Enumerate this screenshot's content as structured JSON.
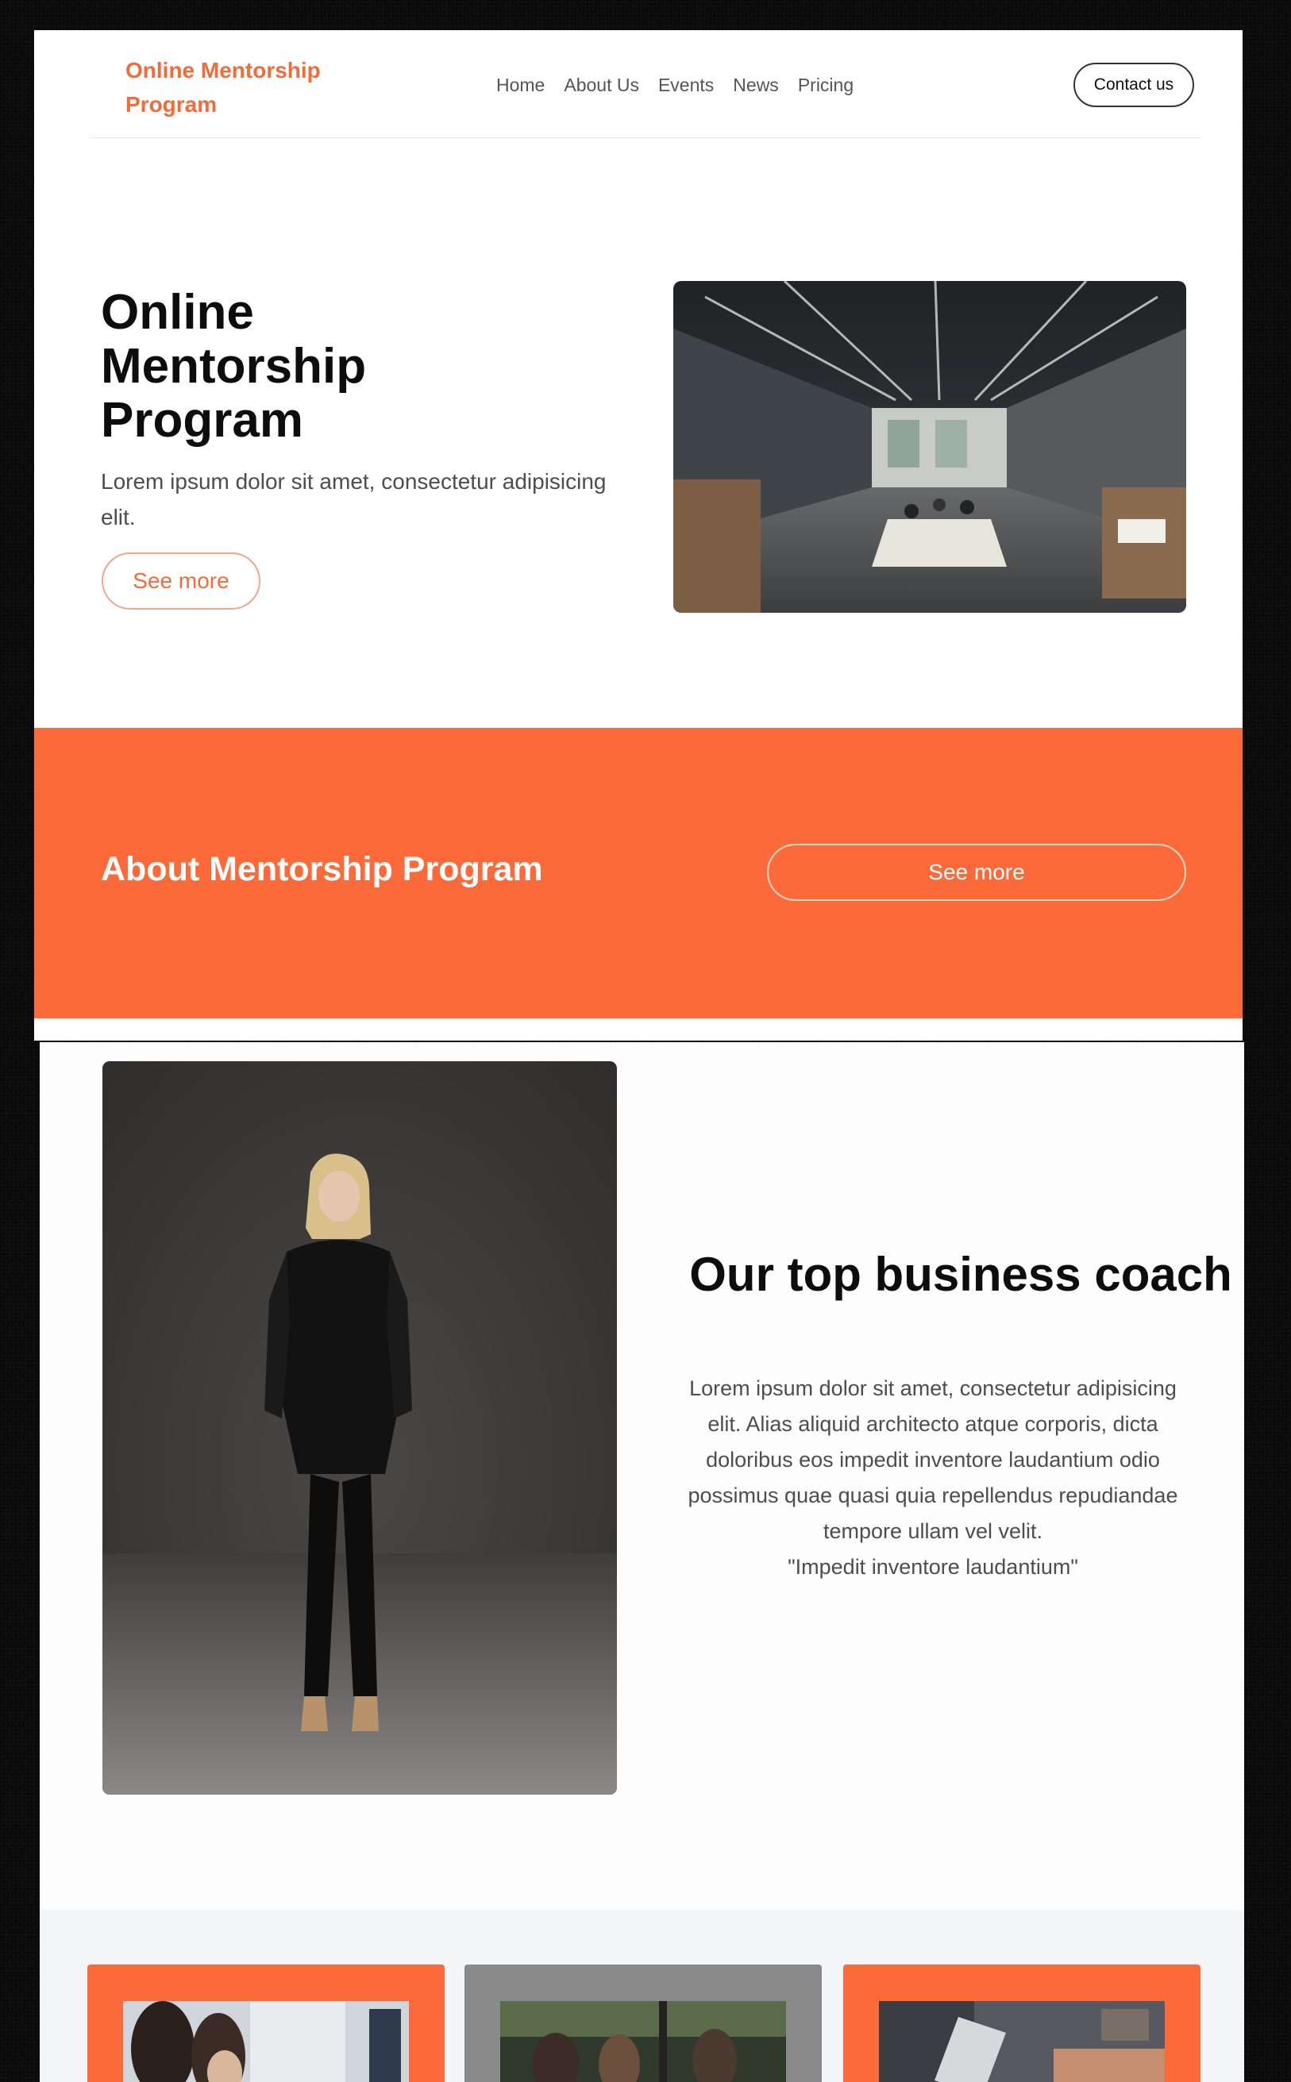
{
  "header": {
    "brand": "Online Mentorship\nProgram",
    "nav": [
      "Home",
      "About Us",
      "Events",
      "News",
      "Pricing"
    ],
    "contact_label": "Contact us"
  },
  "hero": {
    "title": "Online Mentorship Program",
    "text": "Lorem ipsum dolor sit amet, consectetur adipisicing elit.",
    "button_label": "See more"
  },
  "about": {
    "title": "About Mentorship Program",
    "button_label": "See more"
  },
  "coach": {
    "title": "Our top business coach",
    "text": "Lorem ipsum dolor sit amet, consectetur adipisicing elit. Alias aliquid architecto atque corporis, dicta doloribus eos impedit inventore laudantium odio possimus quae quasi quia repellendus repudiandae tempore ullam vel velit.",
    "quote": "\"Impedit inventore laudantium\""
  },
  "cards": [
    {
      "name": "card-meeting",
      "accent": "#fd6a3a"
    },
    {
      "name": "card-team",
      "accent": "#8a8a8a"
    },
    {
      "name": "card-laptop",
      "accent": "#fd6a3a"
    }
  ],
  "colors": {
    "accent": "#fd6a3a",
    "brand_text": "#f26b3a",
    "heading": "#0d0d0d",
    "body_text": "#4d4d4d"
  }
}
